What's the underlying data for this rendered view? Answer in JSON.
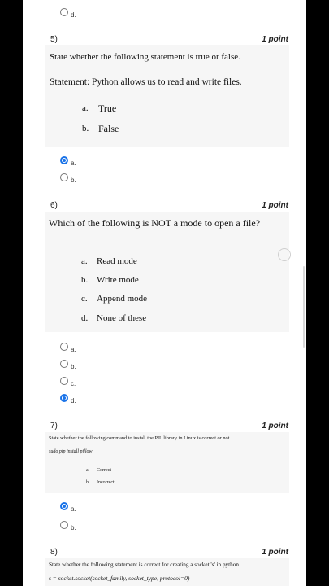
{
  "q4": {
    "radio_d": "d."
  },
  "q5": {
    "number": "5)",
    "points": "1 point",
    "instruction": "State whether the following statement is true or false.",
    "statement": "Statement: Python allows us to read and write files.",
    "options": [
      {
        "letter": "a.",
        "text": "True"
      },
      {
        "letter": "b.",
        "text": "False"
      }
    ],
    "radios": [
      {
        "label": "a.",
        "selected": true
      },
      {
        "label": "b.",
        "selected": false
      }
    ]
  },
  "q6": {
    "number": "6)",
    "points": "1 point",
    "question": "Which of the following is NOT a mode to open a file?",
    "options": [
      {
        "letter": "a.",
        "text": "Read mode"
      },
      {
        "letter": "b.",
        "text": "Write mode"
      },
      {
        "letter": "c.",
        "text": "Append mode"
      },
      {
        "letter": "d.",
        "text": "None of these"
      }
    ],
    "radios": [
      {
        "label": "a.",
        "selected": false
      },
      {
        "label": "b.",
        "selected": false
      },
      {
        "label": "c.",
        "selected": false
      },
      {
        "label": "d.",
        "selected": true
      }
    ]
  },
  "q7": {
    "number": "7)",
    "points": "1 point",
    "question": "State whether the following command to install the PIL library in Linux is correct or not.",
    "command": "sudo pip install pillow",
    "options": [
      {
        "letter": "a.",
        "text": "Correct"
      },
      {
        "letter": "b.",
        "text": "Incorrect"
      }
    ],
    "radios": [
      {
        "label": "a.",
        "selected": true
      },
      {
        "label": "b.",
        "selected": false
      }
    ]
  },
  "q8": {
    "number": "8)",
    "points": "1 point",
    "question": "State whether the following statement is correct for creating a socket 's' in python.",
    "code": "s = socket.socket(socket_family, socket_type, protocol=0)"
  },
  "colors": {
    "accent": "#1a73e8",
    "card": "#f6f6f6",
    "background": "#000000"
  }
}
